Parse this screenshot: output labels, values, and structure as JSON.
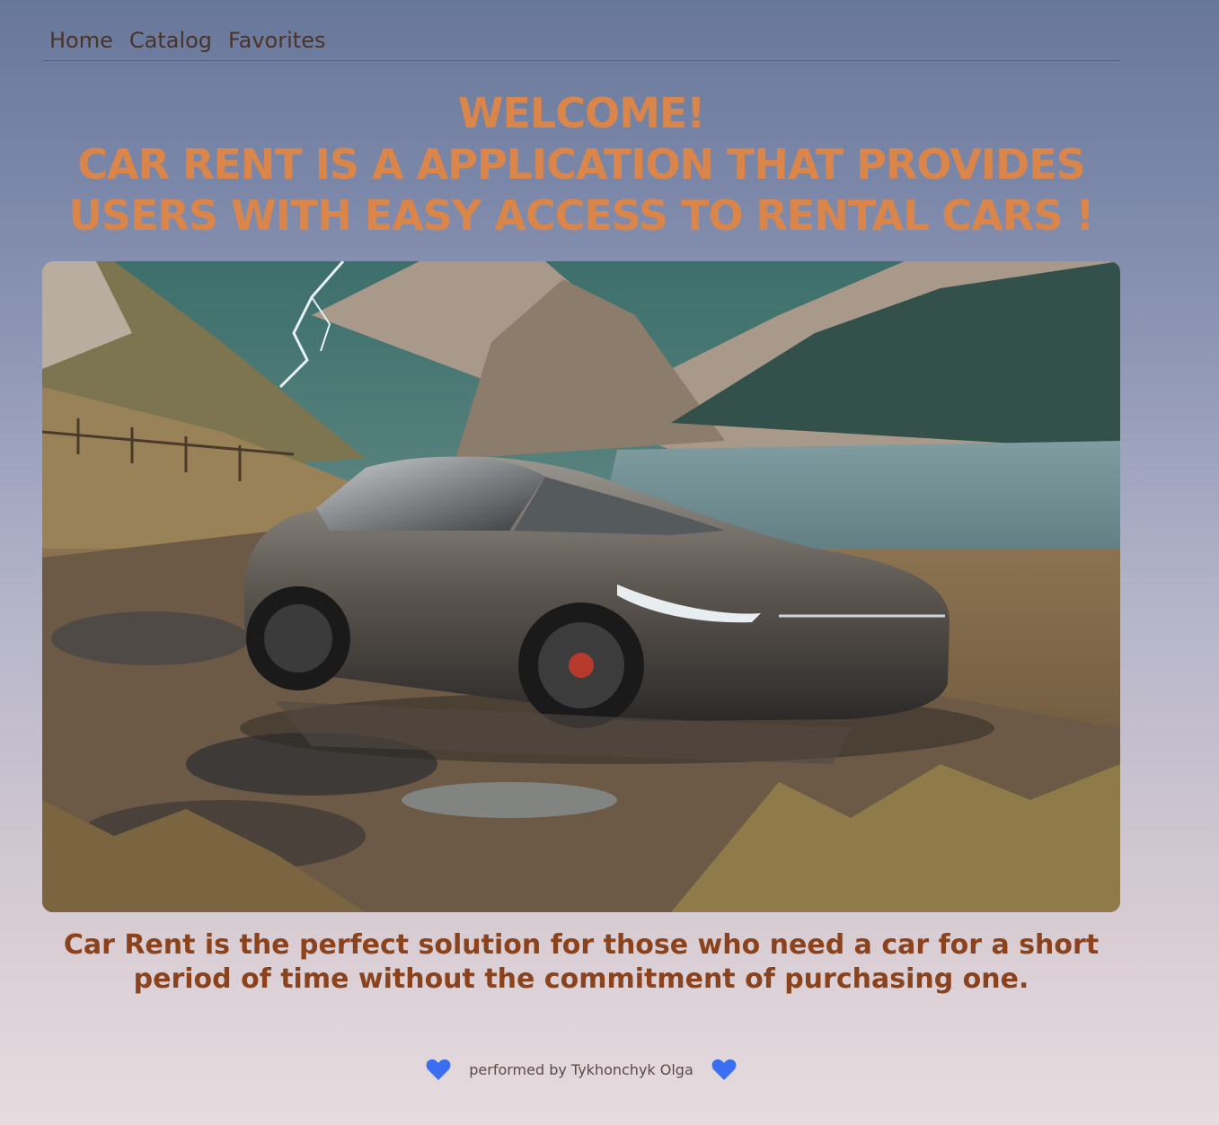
{
  "nav": {
    "items": [
      {
        "label": "Home"
      },
      {
        "label": "Catalog"
      },
      {
        "label": "Favorites"
      }
    ]
  },
  "hero": {
    "headline_lines": [
      "WELCOME!",
      "CAR RENT IS A APPLICATION THAT PROVIDES",
      "USERS WITH EASY ACCESS TO RENTAL CARS !"
    ],
    "tagline_lines": [
      "Car Rent is the perfect solution for those who need a car for a short",
      "period of time without the commitment of purchasing one."
    ]
  },
  "footer": {
    "credit": "performed by Tykhonchyk Olga",
    "left_icon": "heart-icon",
    "right_icon": "heart-icon"
  },
  "colors": {
    "headline": "#da864b",
    "tagline": "#8a431c",
    "nav_text": "#4a3328",
    "heart": "#3b6ef0"
  }
}
